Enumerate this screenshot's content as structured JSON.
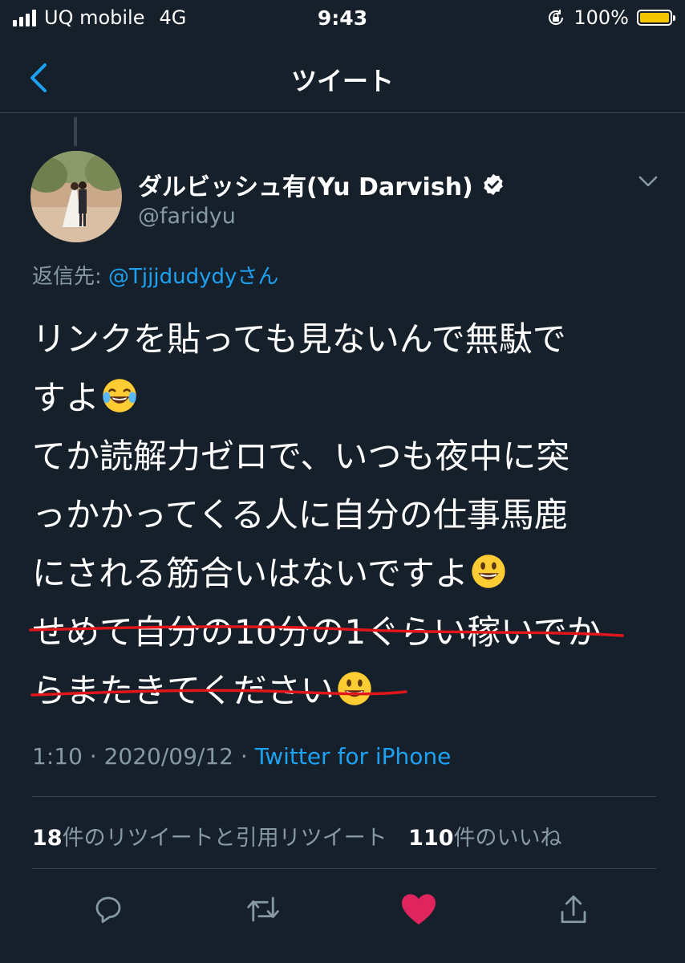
{
  "status_bar": {
    "carrier": "UQ mobile",
    "network": "4G",
    "time": "9:43",
    "battery": "100%"
  },
  "nav": {
    "title": "ツイート"
  },
  "tweet": {
    "display_name": "ダルビッシュ有(Yu Darvish)",
    "handle": "@faridyu",
    "reply_label": "返信先:",
    "reply_mention": "@Tjjjdudydyさん",
    "lines": [
      "リンクを貼っても見ないんで無駄で",
      "すよ",
      "てか読解力ゼロで、いつも夜中に突",
      "っかかってくる人に自分の仕事馬鹿",
      "にされる筋合いはないですよ",
      "せめて自分の10分の1ぐらい稼いでか",
      "らまたきてください"
    ],
    "time": "1:10",
    "date": "2020/09/12",
    "separator": "·",
    "source": "Twitter for iPhone"
  },
  "stats": {
    "retweets_count": "18",
    "retweets_label": "件のリツイートと引用リツイート",
    "likes_count": "110",
    "likes_label": "件のいいね"
  },
  "colors": {
    "background": "#15202b",
    "accent": "#1da1f2",
    "secondary_text": "#8899a6",
    "like": "#e0245e",
    "underline": "#e0161b"
  },
  "icons": [
    "signal-icon",
    "rotation-lock-icon",
    "battery-icon",
    "back-chevron-icon",
    "verified-badge-icon",
    "chevron-down-icon",
    "laughing-emoji-icon",
    "smiley-emoji-icon",
    "reply-icon",
    "retweet-icon",
    "like-heart-icon",
    "share-icon"
  ]
}
